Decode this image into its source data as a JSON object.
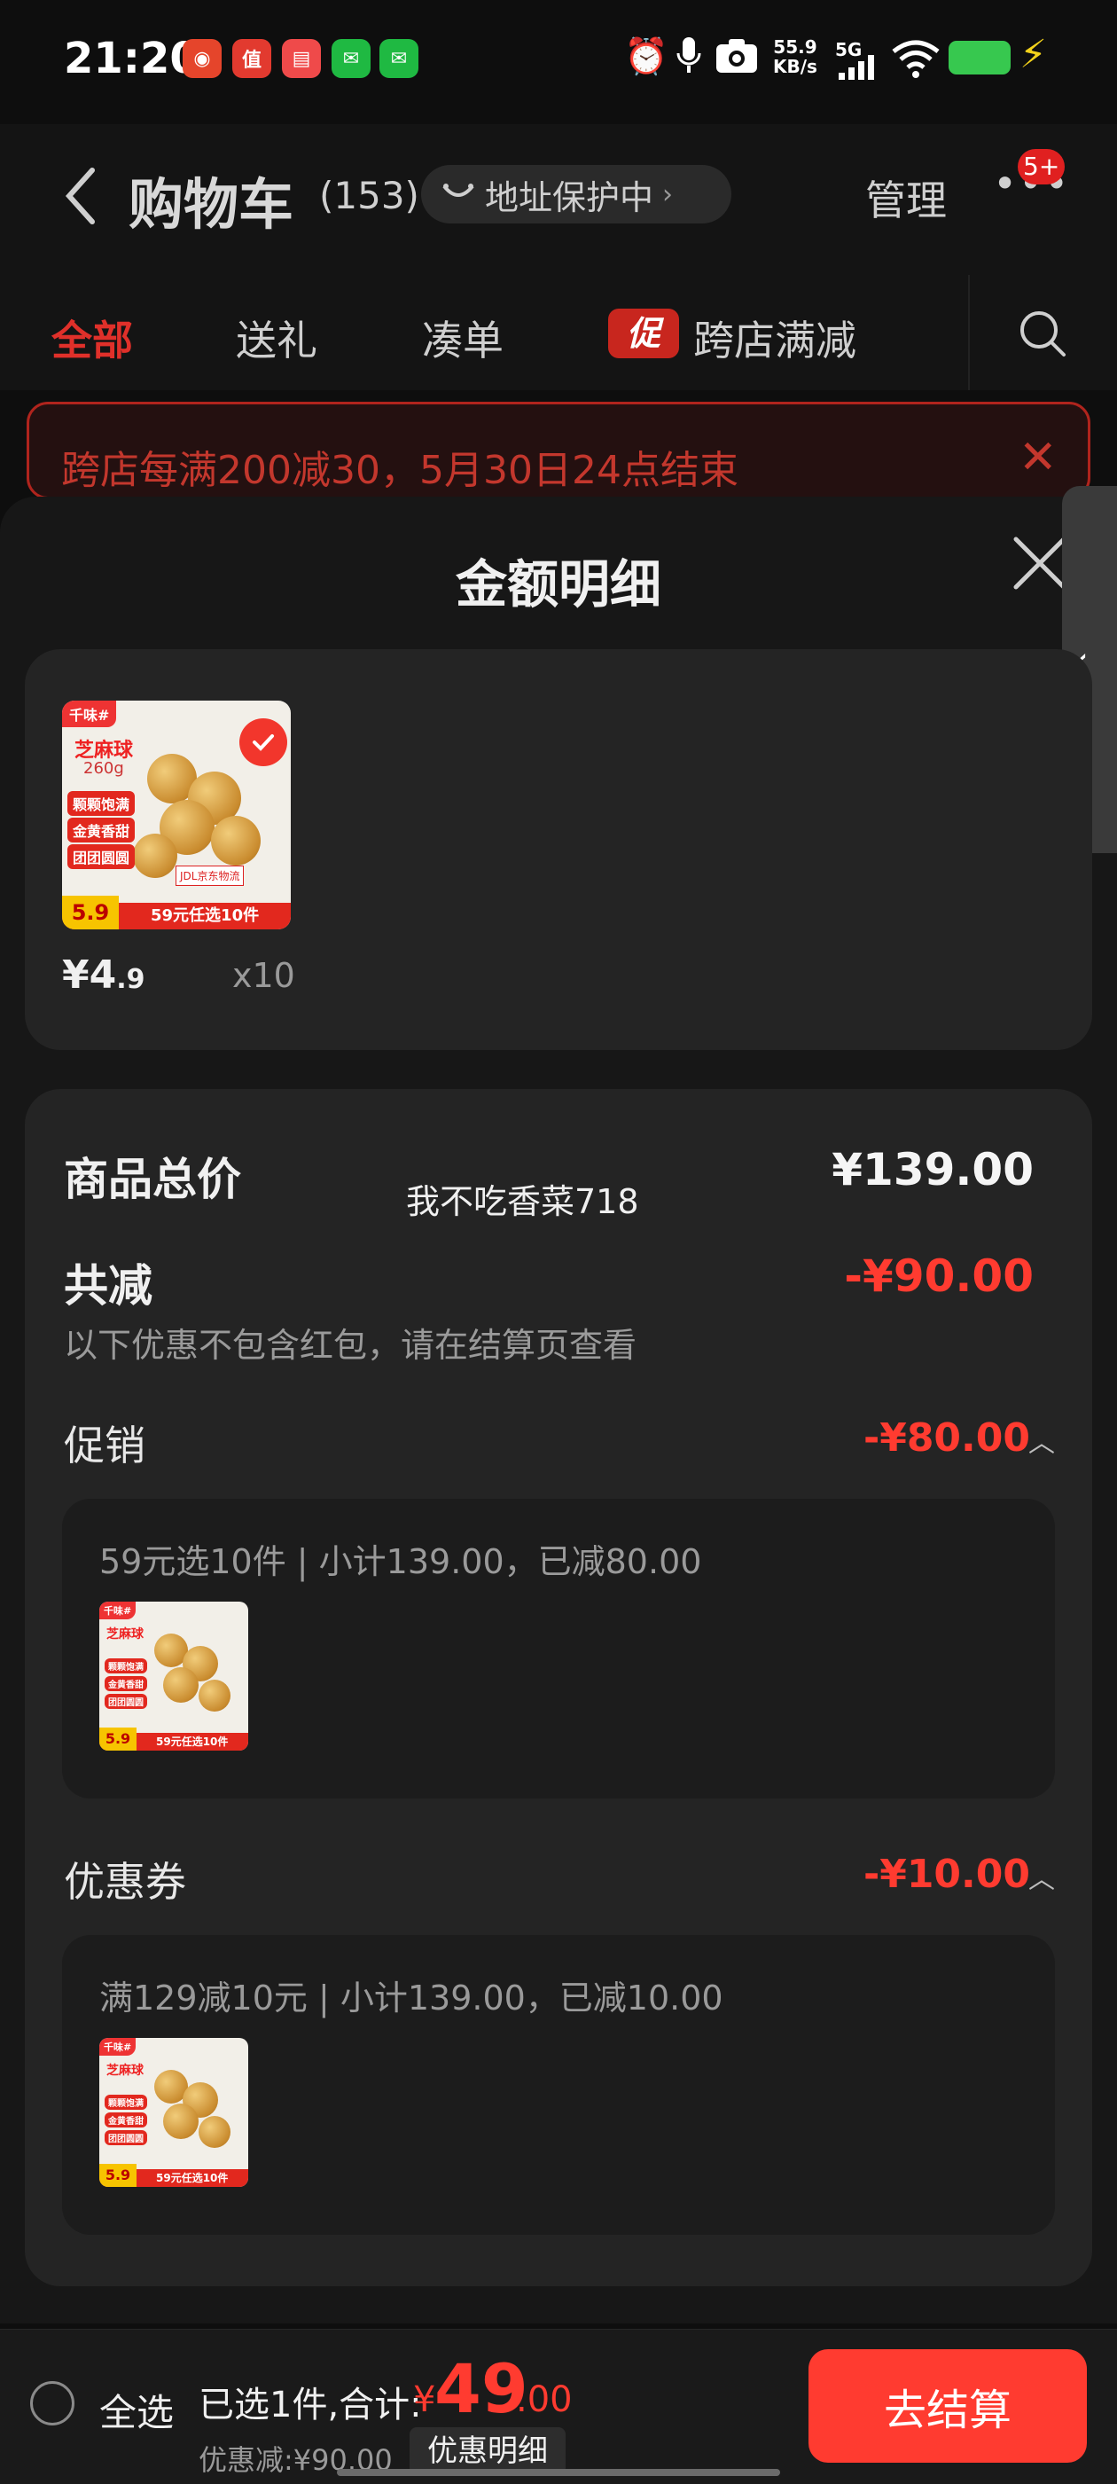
{
  "status_bar": {
    "time": "21:20",
    "net_speed_value": "55.9",
    "net_speed_unit": "KB/s",
    "network": "5G"
  },
  "header": {
    "back_icon": "chevron-left-icon",
    "title": "购物车",
    "count": "(153)",
    "address_protect": "地址保护中",
    "manage": "管理",
    "more_badge": "5+"
  },
  "tabs": [
    {
      "label": "全部",
      "active": true
    },
    {
      "label": "送礼"
    },
    {
      "label": "凑单"
    },
    {
      "label": "跨店满减",
      "tag": "促"
    }
  ],
  "notice": {
    "text": "跨店每满200减30，5月30日24点结束"
  },
  "sheet": {
    "title": "金额明细",
    "item": {
      "price_symbol": "¥",
      "price_int": "4",
      "price_dec": ".9",
      "qty": "x10",
      "thumb": {
        "brand": "千味#",
        "name": "芝麻球",
        "weight": "260g",
        "tags": [
          "颗颗饱满",
          "金黄香甜",
          "团团圆圆"
        ],
        "price": "5.9",
        "promo": "59元任选10件",
        "logistics": "JDL京东物流"
      }
    },
    "summary": {
      "total_label": "商品总价",
      "total_value": "¥139.00",
      "watermark": "我不吃香菜718",
      "discount_label": "共减",
      "discount_value": "-¥90.00",
      "discount_note": "以下优惠不包含红包，请在结算页查看",
      "promo": {
        "label": "促销",
        "value": "-¥80.00",
        "detail": "59元选10件 | 小计139.00，已减80.00"
      },
      "coupon": {
        "label": "优惠券",
        "value": "-¥10.00",
        "detail": "满129减10元 | 小计139.00，已减10.00"
      }
    }
  },
  "bottom_bar": {
    "select_all": "全选",
    "total_label": "已选1件,合计:",
    "total_currency": "¥",
    "total_int": "49",
    "total_dec": ".00",
    "saved": "优惠减:¥90.00",
    "detail_button": "优惠明细",
    "checkout": "去结算"
  },
  "colors": {
    "accent": "#ff3b30",
    "background": "#0e0e0e",
    "card": "#242424"
  }
}
